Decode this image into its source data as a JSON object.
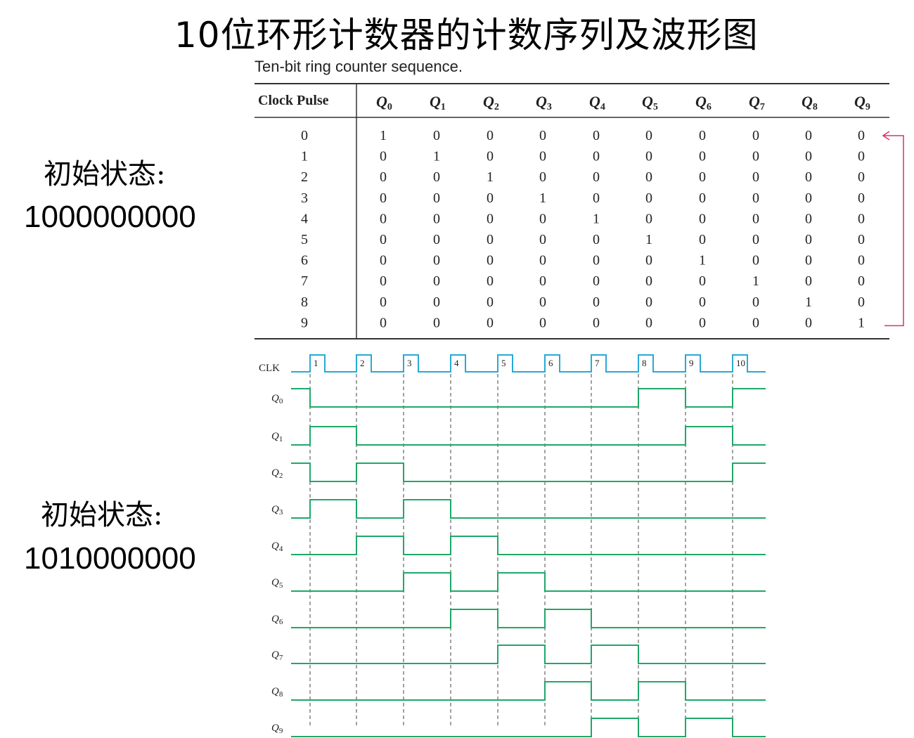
{
  "title": "10位环形计数器的计数序列及波形图",
  "caption": "Ten-bit ring counter sequence.",
  "state_label_1": "初始状态:",
  "state_value_1": "1000000000",
  "state_label_2": "初始状态:",
  "state_value_2": "1010000000",
  "table": {
    "header_first": "Clock Pulse",
    "q_letter": "Q",
    "q_subscripts": [
      "0",
      "1",
      "2",
      "3",
      "4",
      "5",
      "6",
      "7",
      "8",
      "9"
    ],
    "rows": [
      [
        "0",
        "1",
        "0",
        "0",
        "0",
        "0",
        "0",
        "0",
        "0",
        "0",
        "0"
      ],
      [
        "1",
        "0",
        "1",
        "0",
        "0",
        "0",
        "0",
        "0",
        "0",
        "0",
        "0"
      ],
      [
        "2",
        "0",
        "0",
        "1",
        "0",
        "0",
        "0",
        "0",
        "0",
        "0",
        "0"
      ],
      [
        "3",
        "0",
        "0",
        "0",
        "1",
        "0",
        "0",
        "0",
        "0",
        "0",
        "0"
      ],
      [
        "4",
        "0",
        "0",
        "0",
        "0",
        "1",
        "0",
        "0",
        "0",
        "0",
        "0"
      ],
      [
        "5",
        "0",
        "0",
        "0",
        "0",
        "0",
        "1",
        "0",
        "0",
        "0",
        "0"
      ],
      [
        "6",
        "0",
        "0",
        "0",
        "0",
        "0",
        "0",
        "1",
        "0",
        "0",
        "0"
      ],
      [
        "7",
        "0",
        "0",
        "0",
        "0",
        "0",
        "0",
        "0",
        "1",
        "0",
        "0"
      ],
      [
        "8",
        "0",
        "0",
        "0",
        "0",
        "0",
        "0",
        "0",
        "0",
        "1",
        "0"
      ],
      [
        "9",
        "0",
        "0",
        "0",
        "0",
        "0",
        "0",
        "0",
        "0",
        "0",
        "1"
      ]
    ]
  },
  "waveform": {
    "clk_label": "CLK",
    "pulse_numbers": [
      "1",
      "2",
      "3",
      "4",
      "5",
      "6",
      "7",
      "8",
      "9",
      "10"
    ],
    "signal_letter": "Q",
    "signal_subscripts": [
      "0",
      "1",
      "2",
      "3",
      "4",
      "5",
      "6",
      "7",
      "8",
      "9"
    ],
    "initial_levels": [
      1,
      0,
      1,
      0,
      0,
      0,
      0,
      0,
      0,
      0
    ],
    "signals": [
      [
        0,
        0,
        0,
        0,
        0,
        0,
        0,
        1,
        0,
        1
      ],
      [
        1,
        0,
        0,
        0,
        0,
        0,
        0,
        0,
        1,
        0
      ],
      [
        0,
        1,
        0,
        0,
        0,
        0,
        0,
        0,
        0,
        1
      ],
      [
        1,
        0,
        1,
        0,
        0,
        0,
        0,
        0,
        0,
        0
      ],
      [
        0,
        1,
        0,
        1,
        0,
        0,
        0,
        0,
        0,
        0
      ],
      [
        0,
        0,
        1,
        0,
        1,
        0,
        0,
        0,
        0,
        0
      ],
      [
        0,
        0,
        0,
        1,
        0,
        1,
        0,
        0,
        0,
        0
      ],
      [
        0,
        0,
        0,
        0,
        1,
        0,
        1,
        0,
        0,
        0
      ],
      [
        0,
        0,
        0,
        0,
        0,
        1,
        0,
        1,
        0,
        0
      ],
      [
        0,
        0,
        0,
        0,
        0,
        0,
        1,
        0,
        1,
        0
      ]
    ]
  },
  "colors": {
    "clk": "#29a9d6",
    "signal": "#1fa869",
    "arrow": "#d6336c",
    "rule": "#333333",
    "dash": "#444444"
  }
}
